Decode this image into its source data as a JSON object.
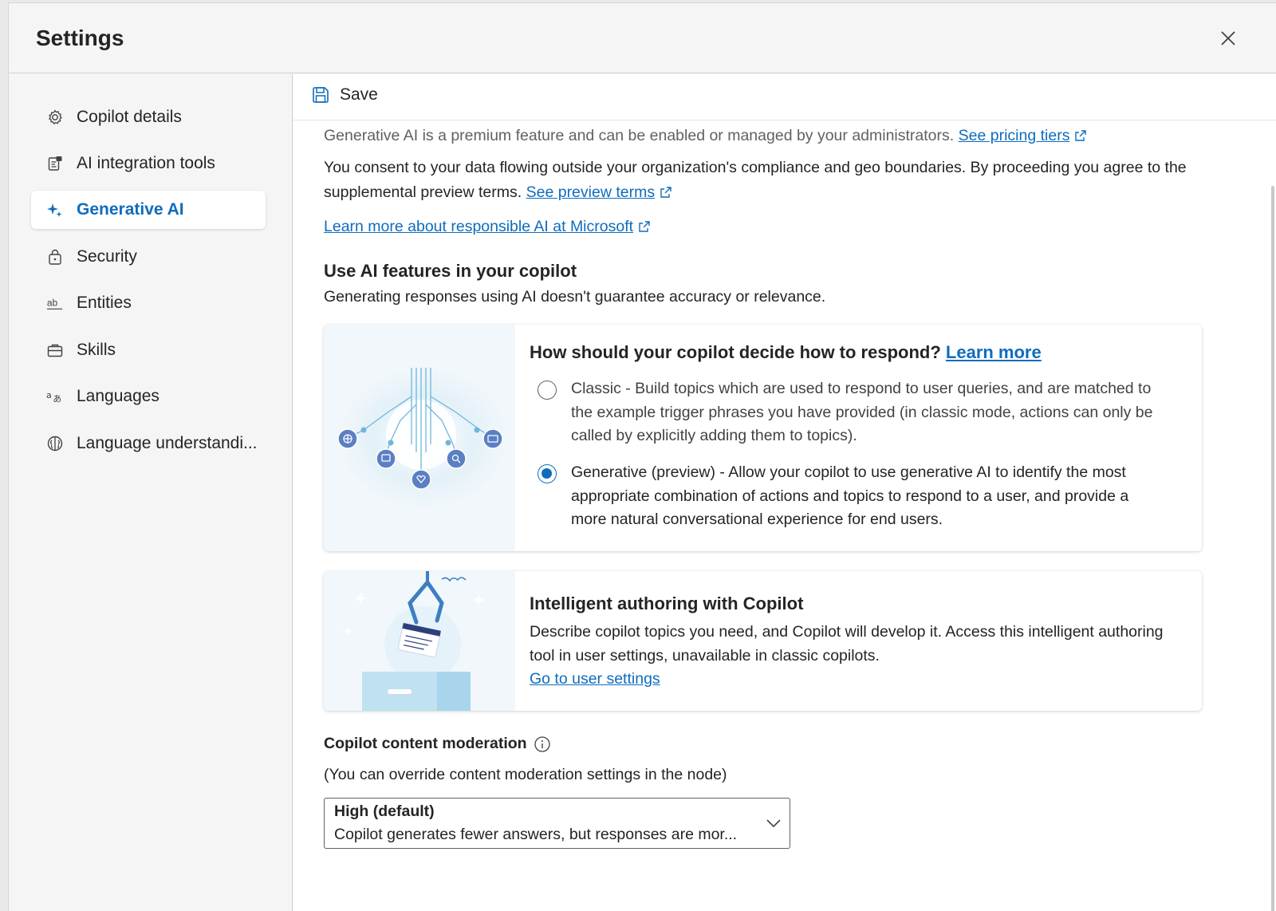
{
  "dialog": {
    "title": "Settings"
  },
  "sidebar": {
    "items": [
      {
        "label": "Copilot details",
        "icon": "gear-icon"
      },
      {
        "label": "AI integration tools",
        "icon": "integration-icon"
      },
      {
        "label": "Generative AI",
        "icon": "sparkle-icon",
        "active": true
      },
      {
        "label": "Security",
        "icon": "lock-icon"
      },
      {
        "label": "Entities",
        "icon": "entity-ab-icon"
      },
      {
        "label": "Skills",
        "icon": "briefcase-icon"
      },
      {
        "label": "Languages",
        "icon": "translate-icon"
      },
      {
        "label": "Language understandi...",
        "icon": "brain-icon"
      }
    ]
  },
  "toolbar": {
    "save_label": "Save"
  },
  "main": {
    "intro_text": "Generative AI is a premium feature and can be enabled or managed by your administrators.",
    "pricing_link": "See pricing tiers",
    "consent_text": "You consent to your data flowing outside your organization's compliance and geo boundaries. By proceeding you agree to the supplemental preview terms.",
    "preview_terms_link": "See preview terms",
    "responsible_ai_link": "Learn more about responsible AI at Microsoft",
    "section_title": "Use AI features in your copilot",
    "section_subtitle": "Generating responses using AI doesn't guarantee accuracy or relevance.",
    "respond_card": {
      "title": "How should your copilot decide how to respond?",
      "learn_more": "Learn more",
      "options": [
        {
          "label": "Classic - Build topics which are used to respond to user queries, and are matched to the example trigger phrases you have provided (in classic mode, actions can only be called by explicitly adding them to topics).",
          "checked": false
        },
        {
          "label": "Generative (preview) - Allow your copilot to use generative AI to identify the most appropriate combination of actions and topics to respond to a user, and provide a more natural conversational experience for end users.",
          "checked": true
        }
      ]
    },
    "authoring_card": {
      "title": "Intelligent authoring with Copilot",
      "description": "Describe copilot topics you need, and Copilot will develop it. Access this intelligent authoring tool in user settings, unavailable in classic copilots.",
      "link": "Go to user settings"
    },
    "moderation": {
      "label": "Copilot content moderation",
      "subtitle": "(You can override content moderation settings in the node)",
      "selected": "High (default)",
      "selected_description": "Copilot generates fewer answers, but responses are mor..."
    }
  },
  "colors": {
    "accent": "#0f6cbd",
    "text": "#242424",
    "muted": "#616161"
  }
}
